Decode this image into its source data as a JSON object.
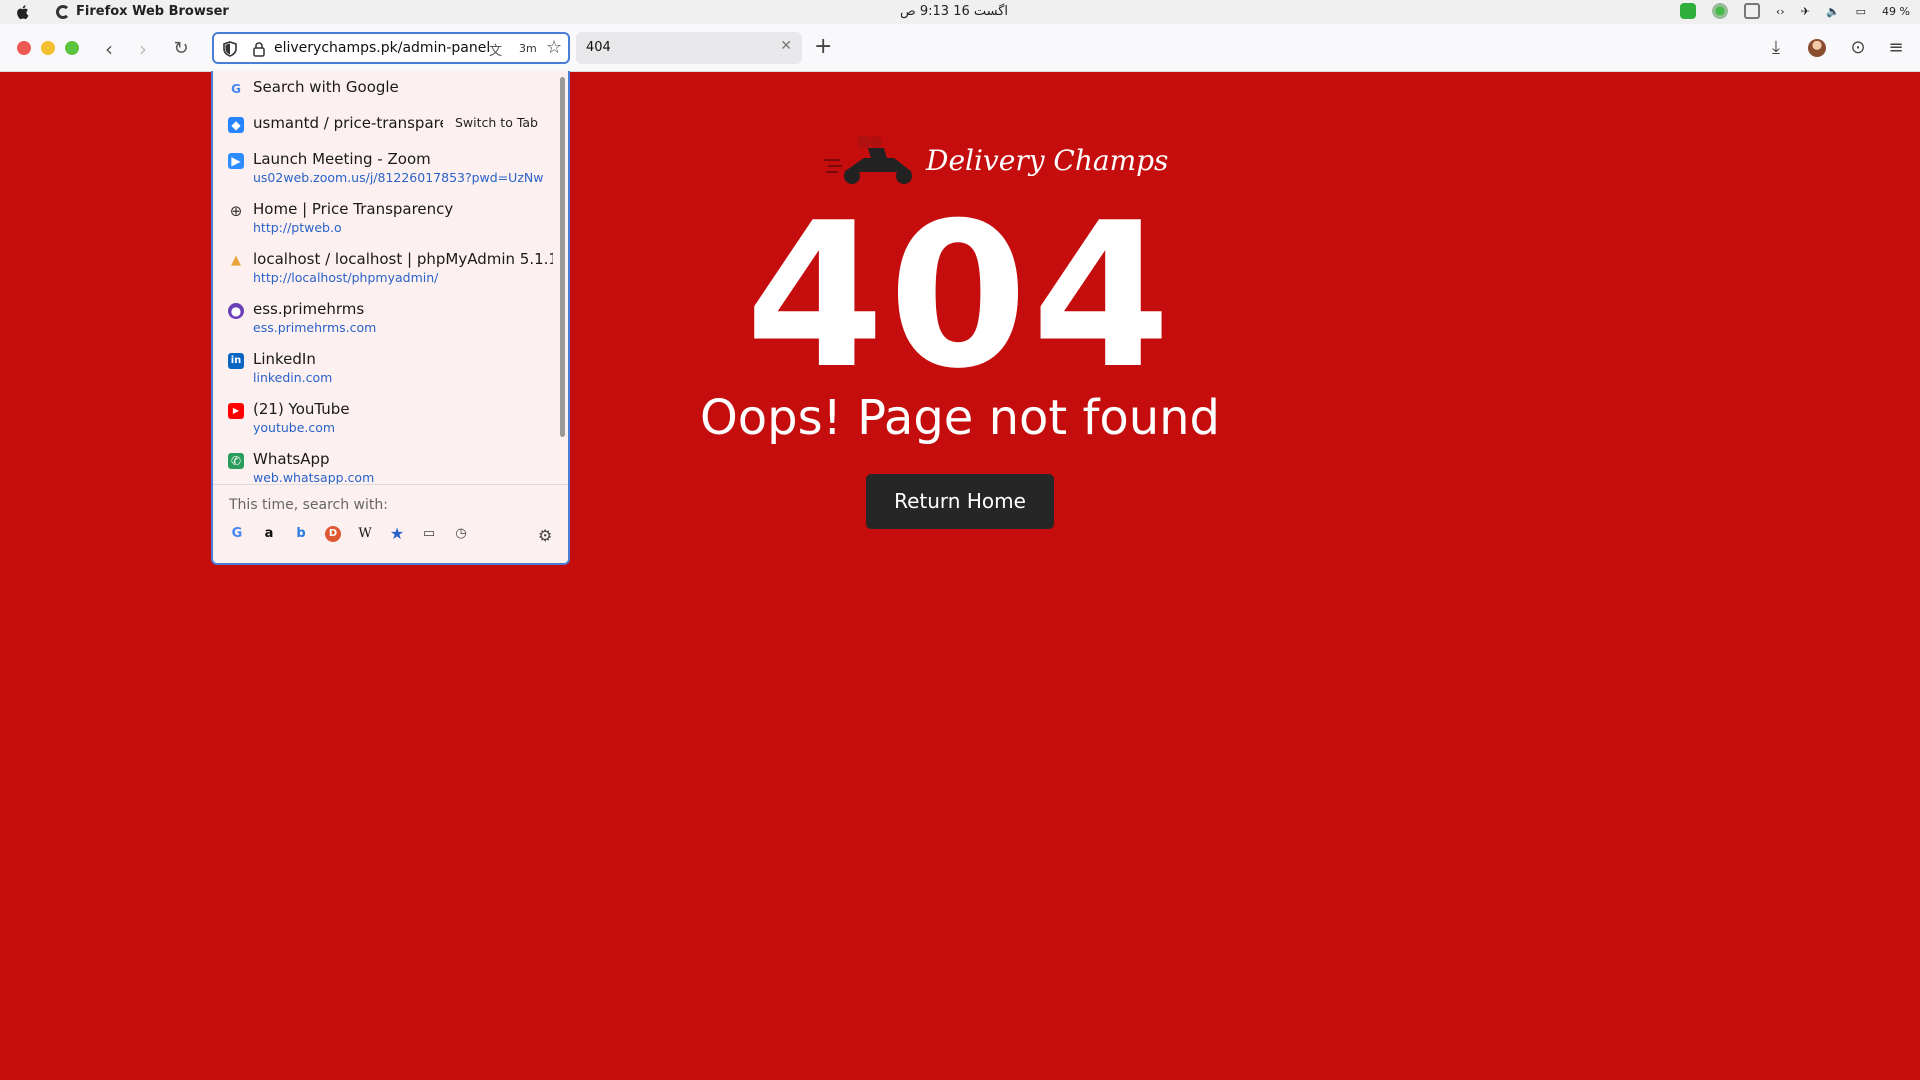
{
  "system_bar": {
    "app_name": "Firefox Web Browser",
    "clock": "اگست 16  9:13 ص",
    "battery": "49 %"
  },
  "browser": {
    "url": "eliverychamps.pk/admin-panel",
    "url_badge": "3m",
    "tab_title": "404",
    "accent_color": "#4a7dd6"
  },
  "dropdown": {
    "suggestions": [
      {
        "title": "Search with Google",
        "url": "",
        "icon": "google-icon",
        "action": ""
      },
      {
        "title": "usmantd / price-transparen",
        "url": "",
        "icon": "bitbucket-icon",
        "action": "Switch to Tab"
      },
      {
        "title": "Launch Meeting - Zoom",
        "url": "us02web.zoom.us/j/81226017853?pwd=UzNwM...",
        "icon": "zoom-icon",
        "action": ""
      },
      {
        "title": "Home | Price Transparency",
        "url": "http://ptweb.o",
        "icon": "globe-icon",
        "action": ""
      },
      {
        "title": "localhost / localhost | phpMyAdmin 5.1.1",
        "url": "http://localhost/phpmyadmin/",
        "icon": "phpmyadmin-icon",
        "action": ""
      },
      {
        "title": "ess.primehrms",
        "url": "ess.primehrms.com",
        "icon": "primehrms-icon",
        "action": ""
      },
      {
        "title": "LinkedIn",
        "url": "linkedin.com",
        "icon": "linkedin-icon",
        "action": ""
      },
      {
        "title": "(21) YouTube",
        "url": "youtube.com",
        "icon": "youtube-icon",
        "action": ""
      },
      {
        "title": "WhatsApp",
        "url": "web.whatsapp.com",
        "icon": "whatsapp-icon",
        "action": ""
      }
    ],
    "search_with_label": "This time, search with:",
    "engines": [
      "google-icon",
      "amazon-icon",
      "bing-icon",
      "duckduckgo-icon",
      "wikipedia-icon",
      "bookmarks-icon",
      "tabs-icon",
      "history-icon"
    ]
  },
  "page": {
    "logo_text": "Delivery Champs",
    "error_code": "404",
    "message": "Oops! Page not found",
    "button_label": "Return Home",
    "background_color": "#c50d0e",
    "button_color": "#262626"
  }
}
